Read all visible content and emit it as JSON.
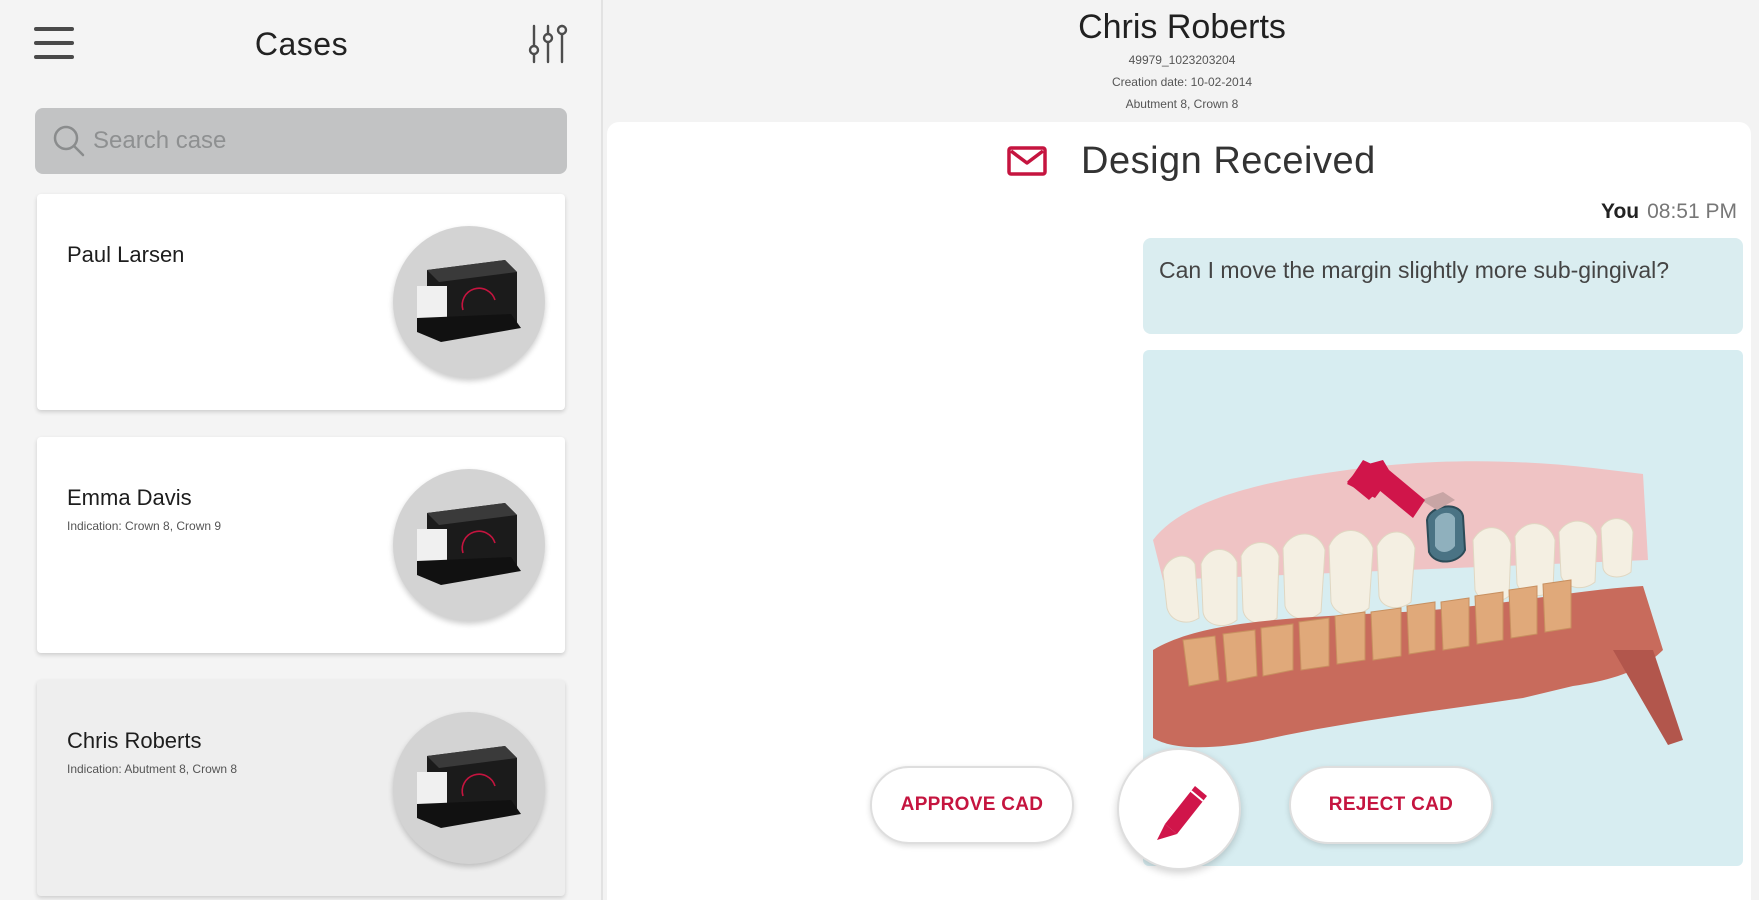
{
  "sidebar": {
    "title": "Cases",
    "search": {
      "placeholder": "Search case",
      "value": ""
    },
    "cases": [
      {
        "name": "Paul Larsen",
        "indication": ""
      },
      {
        "name": "Emma Davis",
        "indication": "Indication: Crown 8, Crown 9"
      },
      {
        "name": "Chris Roberts",
        "indication": "Indication: Abutment 8, Crown 8"
      }
    ]
  },
  "header": {
    "patient_name": "Chris Roberts",
    "case_id": "49979_1023203204",
    "creation_date": "Creation date: 10-02-2014",
    "indication": "Abutment 8, Crown 8"
  },
  "conversation": {
    "status_title": "Design Received",
    "sender": "You",
    "time": "08:51 PM",
    "message": "Can I move the margin slightly more sub-gingival?"
  },
  "actions": {
    "approve_label": "APPROVE CAD",
    "reject_label": "REJECT CAD"
  },
  "colors": {
    "accent": "#c5143f",
    "message_bubble": "#daedf0",
    "search_bg": "#c2c3c4"
  },
  "icons": [
    "menu-icon",
    "filter-sliders-icon",
    "search-icon",
    "scanner-icon",
    "mail-icon",
    "pencil-icon"
  ]
}
